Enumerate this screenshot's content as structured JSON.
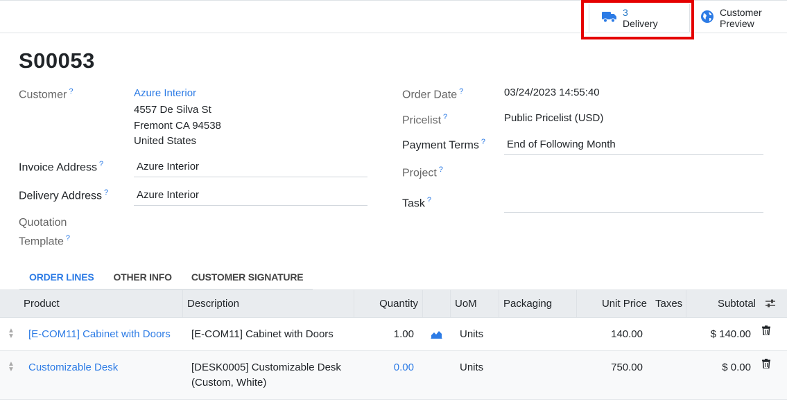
{
  "stat_buttons": {
    "delivery": {
      "count": "3",
      "label": "Delivery"
    },
    "preview": {
      "line1": "Customer",
      "line2": "Preview"
    }
  },
  "record": {
    "name": "S00053"
  },
  "fields": {
    "customer_label": "Customer",
    "customer_name": "Azure Interior",
    "customer_address": [
      "4557 De Silva St",
      "Fremont CA 94538",
      "United States"
    ],
    "invoice_address_label": "Invoice Address",
    "invoice_address": "Azure Interior",
    "delivery_address_label": "Delivery Address",
    "delivery_address": "Azure Interior",
    "quotation_template_label_1": "Quotation",
    "quotation_template_label_2": "Template",
    "order_date_label": "Order Date",
    "order_date": "03/24/2023 14:55:40",
    "pricelist_label": "Pricelist",
    "pricelist": "Public Pricelist (USD)",
    "payment_terms_label": "Payment Terms",
    "payment_terms": "End of Following Month",
    "project_label": "Project",
    "task_label": "Task",
    "help_mark": "?"
  },
  "tabs": [
    {
      "label": "ORDER LINES",
      "active": true
    },
    {
      "label": "OTHER INFO",
      "active": false
    },
    {
      "label": "CUSTOMER SIGNATURE",
      "active": false
    }
  ],
  "table": {
    "headers": [
      "Product",
      "Description",
      "Quantity",
      "UoM",
      "Packaging",
      "Unit Price",
      "Taxes",
      "Subtotal"
    ],
    "rows": [
      {
        "product": "[E-COM11] Cabinet with Doors",
        "description_1": "[E-COM11] Cabinet with Doors",
        "description_2": "",
        "quantity": "1.00",
        "uom": "Units",
        "unit_price": "140.00",
        "subtotal": "$ 140.00"
      },
      {
        "product": "Customizable Desk",
        "description_1": "[DESK0005] Customizable Desk",
        "description_2": "(Custom, White)",
        "quantity": "0.00",
        "uom": "Units",
        "unit_price": "750.00",
        "subtotal": "$ 0.00"
      }
    ]
  },
  "icons": {
    "truck": "truck-icon",
    "globe": "globe-icon",
    "forecast": "area-chart-icon",
    "trash": "trash-icon",
    "optional_columns": "sliders-icon",
    "handle": "drag-handle-icon"
  },
  "colors": {
    "link": "#2c7be5",
    "highlight": "#e50000",
    "header_bg": "#e9ecef"
  }
}
